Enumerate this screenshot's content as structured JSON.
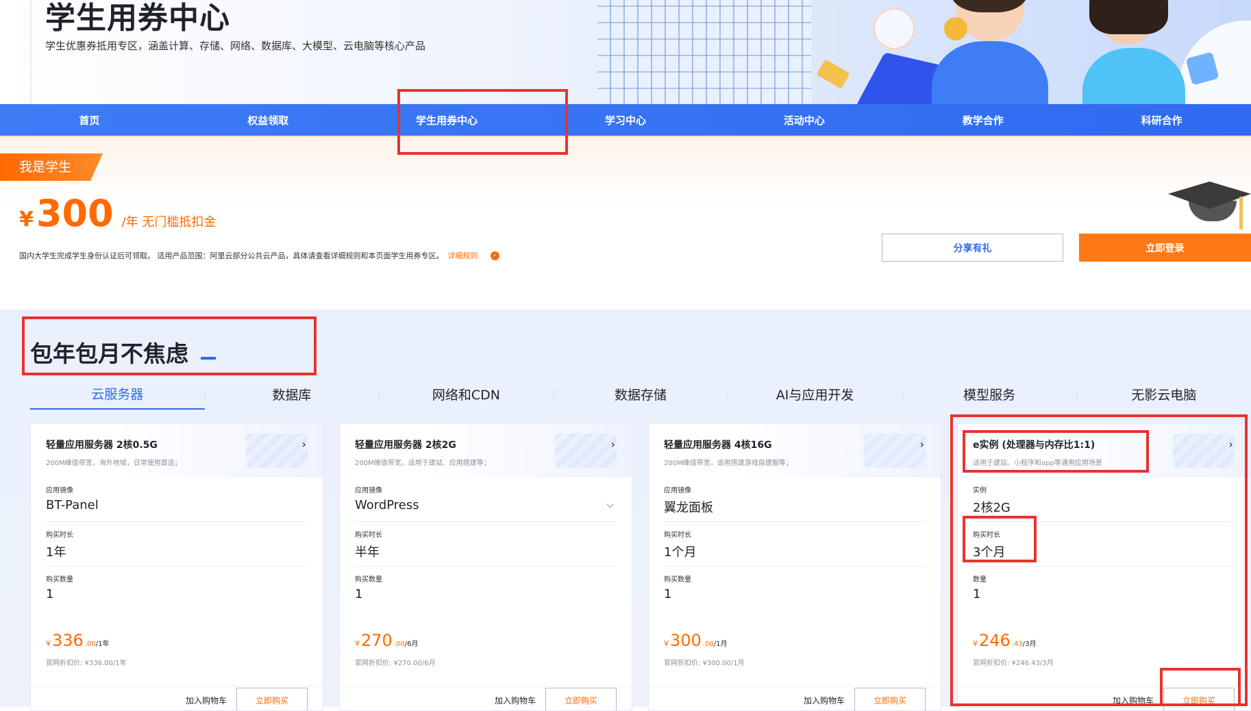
{
  "hero": {
    "title": "学生用券中心",
    "subtitle": "学生优惠券抵用专区，涵盖计算、存储、网络、数据库、大模型、云电脑等核心产品"
  },
  "nav": {
    "items": [
      "首页",
      "权益领取",
      "学生用券中心",
      "学习中心",
      "活动中心",
      "教学合作",
      "科研合作"
    ],
    "active_index": 2
  },
  "student_panel": {
    "tag": "我是学生",
    "currency": "¥",
    "amount": "300",
    "note": "/年 无门槛抵扣金",
    "description": "国内大学生完成学生身份认证后可领取。 适用产品范围：阿里云部分公共云产品，具体请查看详细规则和本页面学生用券专区。",
    "rule_link": "详细规则",
    "share_button": "分享有礼",
    "login_button": "立即登录"
  },
  "section": {
    "title": "包年包月不焦虑",
    "tabs": [
      "云服务器",
      "数据库",
      "网络和CDN",
      "数据存储",
      "AI与应用开发",
      "模型服务",
      "无影云电脑"
    ],
    "active_tab": 0
  },
  "cards": [
    {
      "name": "轻量应用服务器 2核0.5G",
      "features": "200M峰值带宽，海外地域，日常使用首选；",
      "fields": [
        {
          "label": "应用镜像",
          "value": "BT-Panel"
        },
        {
          "label": "购买时长",
          "value": "1年"
        },
        {
          "label": "购买数量",
          "value": "1"
        }
      ],
      "price_yen": "¥",
      "price_int": "336",
      "price_dec": ".00",
      "price_unit": "/1年",
      "original": "官网折扣价: ¥336.00/1年",
      "cart": "加入购物车",
      "buy": "立即购买"
    },
    {
      "name": "轻量应用服务器 2核2G",
      "features": "200M峰值带宽，适用于建站、应用搭建等；",
      "fields": [
        {
          "label": "应用镜像",
          "value": "WordPress"
        },
        {
          "label": "购买时长",
          "value": "半年"
        },
        {
          "label": "购买数量",
          "value": "1"
        }
      ],
      "price_yen": "¥",
      "price_int": "270",
      "price_dec": ".00",
      "price_unit": "/6月",
      "original": "官网折扣价: ¥270.00/6月",
      "cart": "加入购物车",
      "buy": "立即购买"
    },
    {
      "name": "轻量应用服务器 4核16G",
      "features": "200M峰值带宽，适用搭建游戏自建服等；",
      "fields": [
        {
          "label": "应用镜像",
          "value": "翼龙面板"
        },
        {
          "label": "购买时长",
          "value": "1个月"
        },
        {
          "label": "购买数量",
          "value": "1"
        }
      ],
      "price_yen": "¥",
      "price_int": "300",
      "price_dec": ".00",
      "price_unit": "/1月",
      "original": "官网折扣价: ¥300.00/1月",
      "cart": "加入购物车",
      "buy": "立即购买"
    },
    {
      "name": "e实例 (处理器与内存比1:1)",
      "features": "适用于建站、小程序和app等通用应用场景",
      "fields": [
        {
          "label": "实例",
          "value": "2核2G"
        },
        {
          "label": "购买时长",
          "value": "3个月"
        },
        {
          "label": "数量",
          "value": "1"
        }
      ],
      "price_yen": "¥",
      "price_int": "246",
      "price_dec": ".43",
      "price_unit": "/3月",
      "original": "官网折扣价: ¥246.43/3月",
      "cart": "加入购物车",
      "buy": "立即购买"
    }
  ],
  "colors": {
    "brand_blue": "#3069f0",
    "accent_orange": "#ff6a00",
    "annotation_red": "#e8332f"
  },
  "icons": [
    "chevron-right-icon",
    "chevron-down-icon",
    "arrow-circle-icon",
    "graduation-cap-icon"
  ]
}
